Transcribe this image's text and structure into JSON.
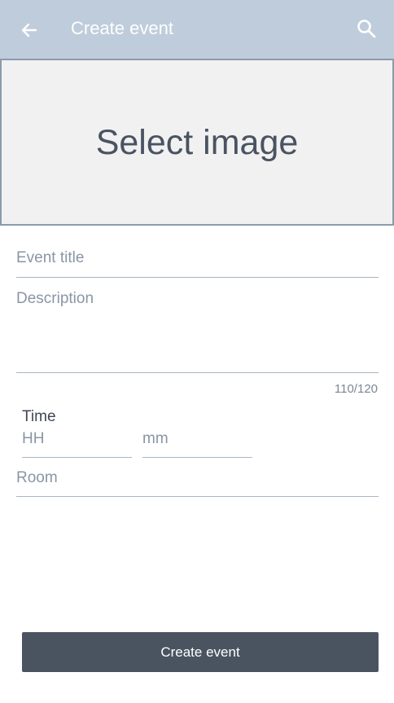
{
  "app_bar": {
    "title": "Create event",
    "back_icon": "arrow-left-icon",
    "search_icon": "search-icon",
    "background": "#bfccdb"
  },
  "image_picker": {
    "label": "Select image"
  },
  "form": {
    "title_placeholder": "Event title",
    "description_placeholder": "Description",
    "description_counter": "110/120",
    "time_label": "Time",
    "hours_placeholder": "HH",
    "minutes_placeholder": "mm",
    "room_placeholder": "Room"
  },
  "actions": {
    "create_label": "Create event",
    "button_color": "#4a5461"
  }
}
